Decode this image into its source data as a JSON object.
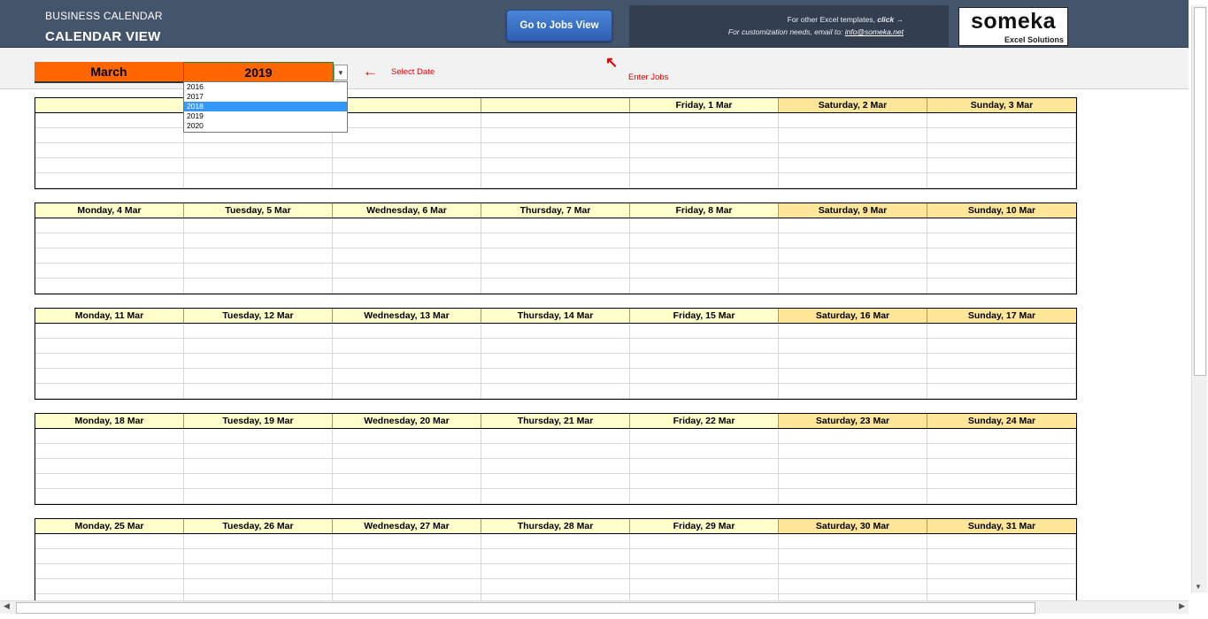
{
  "header": {
    "subtitle": "BUSINESS CALENDAR",
    "title": "CALENDAR VIEW",
    "jobs_button": "Go to Jobs View",
    "templates_text": "For other Excel templates,",
    "templates_link": "click",
    "email_text": "For customization needs, email to:",
    "email_link": "info@someka.net",
    "logo_brand": "someka",
    "logo_tagline": "Excel Solutions"
  },
  "controls": {
    "month": "March",
    "year": "2019",
    "year_options": [
      "2016",
      "2017",
      "2018",
      "2019",
      "2020"
    ],
    "highlighted_option": "2018",
    "select_date_note": "Select Date",
    "enter_jobs_note": "Enter Jobs"
  },
  "weeks": [
    {
      "days": [
        "",
        "",
        "",
        "",
        "Friday, 1 Mar",
        "Saturday, 2 Mar",
        "Sunday, 3 Mar"
      ]
    },
    {
      "days": [
        "Monday, 4 Mar",
        "Tuesday, 5 Mar",
        "Wednesday, 6 Mar",
        "Thursday, 7 Mar",
        "Friday, 8 Mar",
        "Saturday, 9 Mar",
        "Sunday, 10 Mar"
      ]
    },
    {
      "days": [
        "Monday, 11 Mar",
        "Tuesday, 12 Mar",
        "Wednesday, 13 Mar",
        "Thursday, 14 Mar",
        "Friday, 15 Mar",
        "Saturday, 16 Mar",
        "Sunday, 17 Mar"
      ]
    },
    {
      "days": [
        "Monday, 18 Mar",
        "Tuesday, 19 Mar",
        "Wednesday, 20 Mar",
        "Thursday, 21 Mar",
        "Friday, 22 Mar",
        "Saturday, 23 Mar",
        "Sunday, 24 Mar"
      ]
    },
    {
      "days": [
        "Monday, 25 Mar",
        "Tuesday, 26 Mar",
        "Wednesday, 27 Mar",
        "Thursday, 28 Mar",
        "Friday, 29 Mar",
        "Saturday, 30 Mar",
        "Sunday, 31 Mar"
      ]
    }
  ],
  "colors": {
    "banner": "#44546a",
    "accent_orange": "#ff6600",
    "weekday_header": "#ffffcc",
    "weekend_header": "#ffe699",
    "annotation_red": "#e00000"
  }
}
